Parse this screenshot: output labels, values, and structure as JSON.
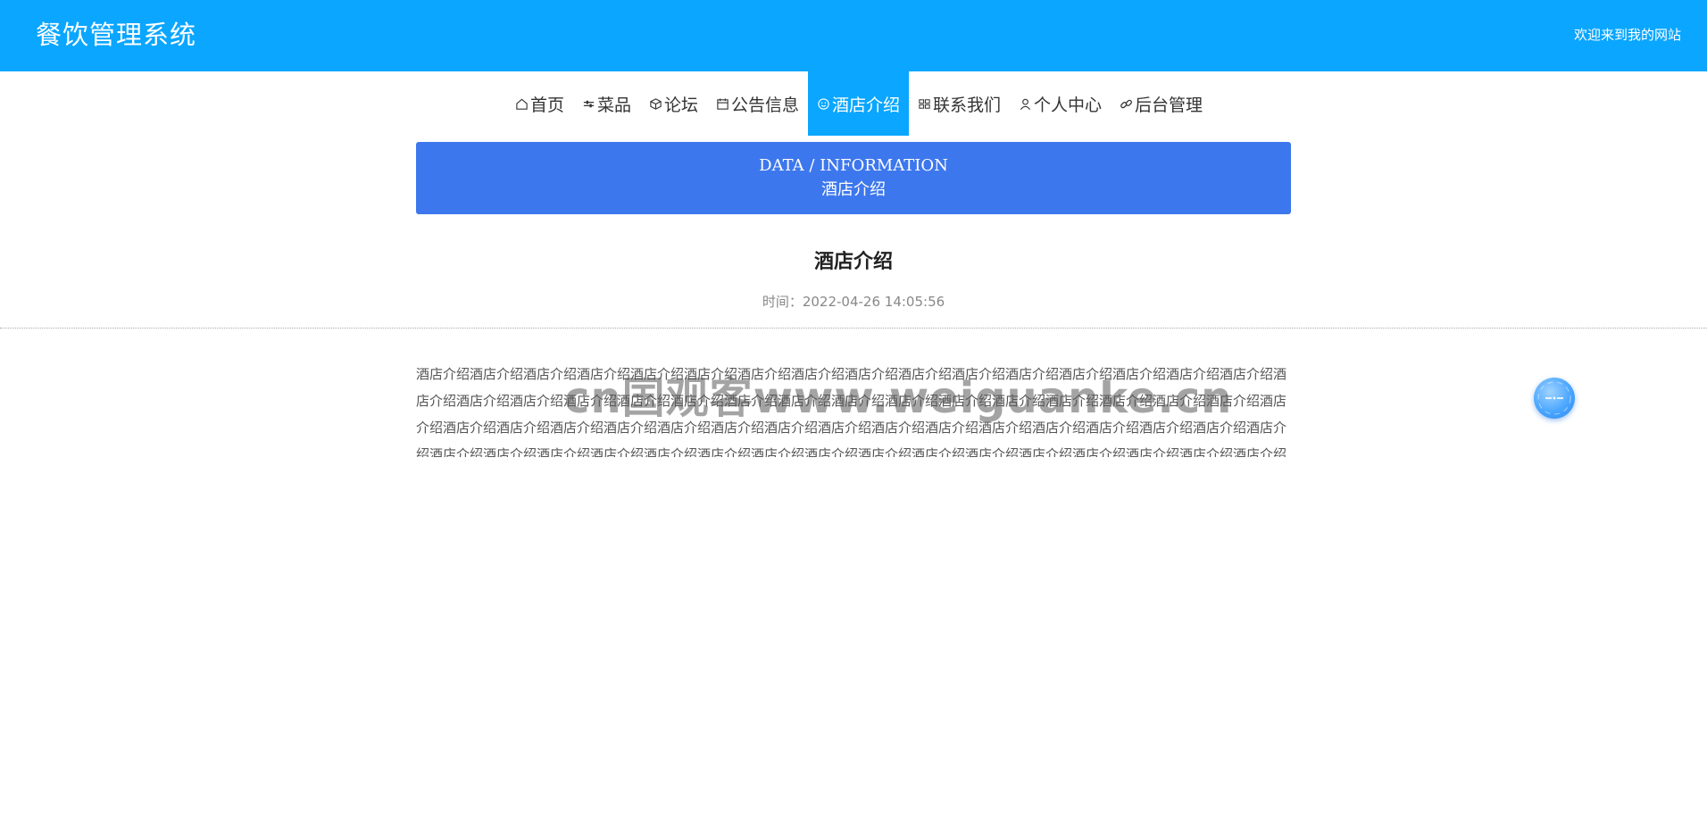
{
  "header": {
    "site_title": "餐饮管理系统",
    "welcome": "欢迎来到我的网站",
    "background_color": "#0aa6ff"
  },
  "nav": {
    "active_color": "#0aa6ff",
    "items": [
      {
        "label": "首页",
        "icon": "home-icon"
      },
      {
        "label": "菜品",
        "icon": "sliders-icon"
      },
      {
        "label": "论坛",
        "icon": "cube-icon"
      },
      {
        "label": "公告信息",
        "icon": "calendar-icon"
      },
      {
        "label": "酒店介绍",
        "icon": "smile-icon",
        "active": true
      },
      {
        "label": "联系我们",
        "icon": "grid-icon"
      },
      {
        "label": "个人中心",
        "icon": "user-icon"
      },
      {
        "label": "后台管理",
        "icon": "link-icon"
      }
    ]
  },
  "banner": {
    "title_en": "DATA / INFORMATION",
    "title_cn": "酒店介绍",
    "background_color": "#3d77ed"
  },
  "article": {
    "title": "酒店介绍",
    "meta": "时间：2022-04-26 14:05:56",
    "body": "酒店介绍酒店介绍酒店介绍酒店介绍酒店介绍酒店介绍酒店介绍酒店介绍酒店介绍酒店介绍酒店介绍酒店介绍酒店介绍酒店介绍酒店介绍酒店介绍酒店介绍酒店介绍酒店介绍酒店介绍酒店介绍酒店介绍酒店介绍酒店介绍酒店介绍酒店介绍酒店介绍酒店介绍酒店介绍酒店介绍酒店介绍酒店介绍酒店介绍酒店介绍酒店介绍酒店介绍酒店介绍酒店介绍酒店介绍酒店介绍酒店介绍酒店介绍酒店介绍酒店介绍酒店介绍酒店介绍酒店介绍酒店介绍酒店介绍酒店介绍酒店介绍酒店介绍酒店介绍酒店介绍酒店介绍酒店介绍酒店介绍酒店介绍酒店介绍酒店介绍酒店介绍酒店介绍酒店介绍酒店介绍酒店介绍酒店介绍酒店介绍酒店介绍酒店介绍酒店介绍酒店介绍酒店介绍酒店介绍酒店介绍酒店介绍酒店介绍酒店介绍酒店介绍"
  },
  "watermark": "cn国观客www.weiguanke.cn",
  "float_button": {
    "icon": "float-menu-icon"
  }
}
